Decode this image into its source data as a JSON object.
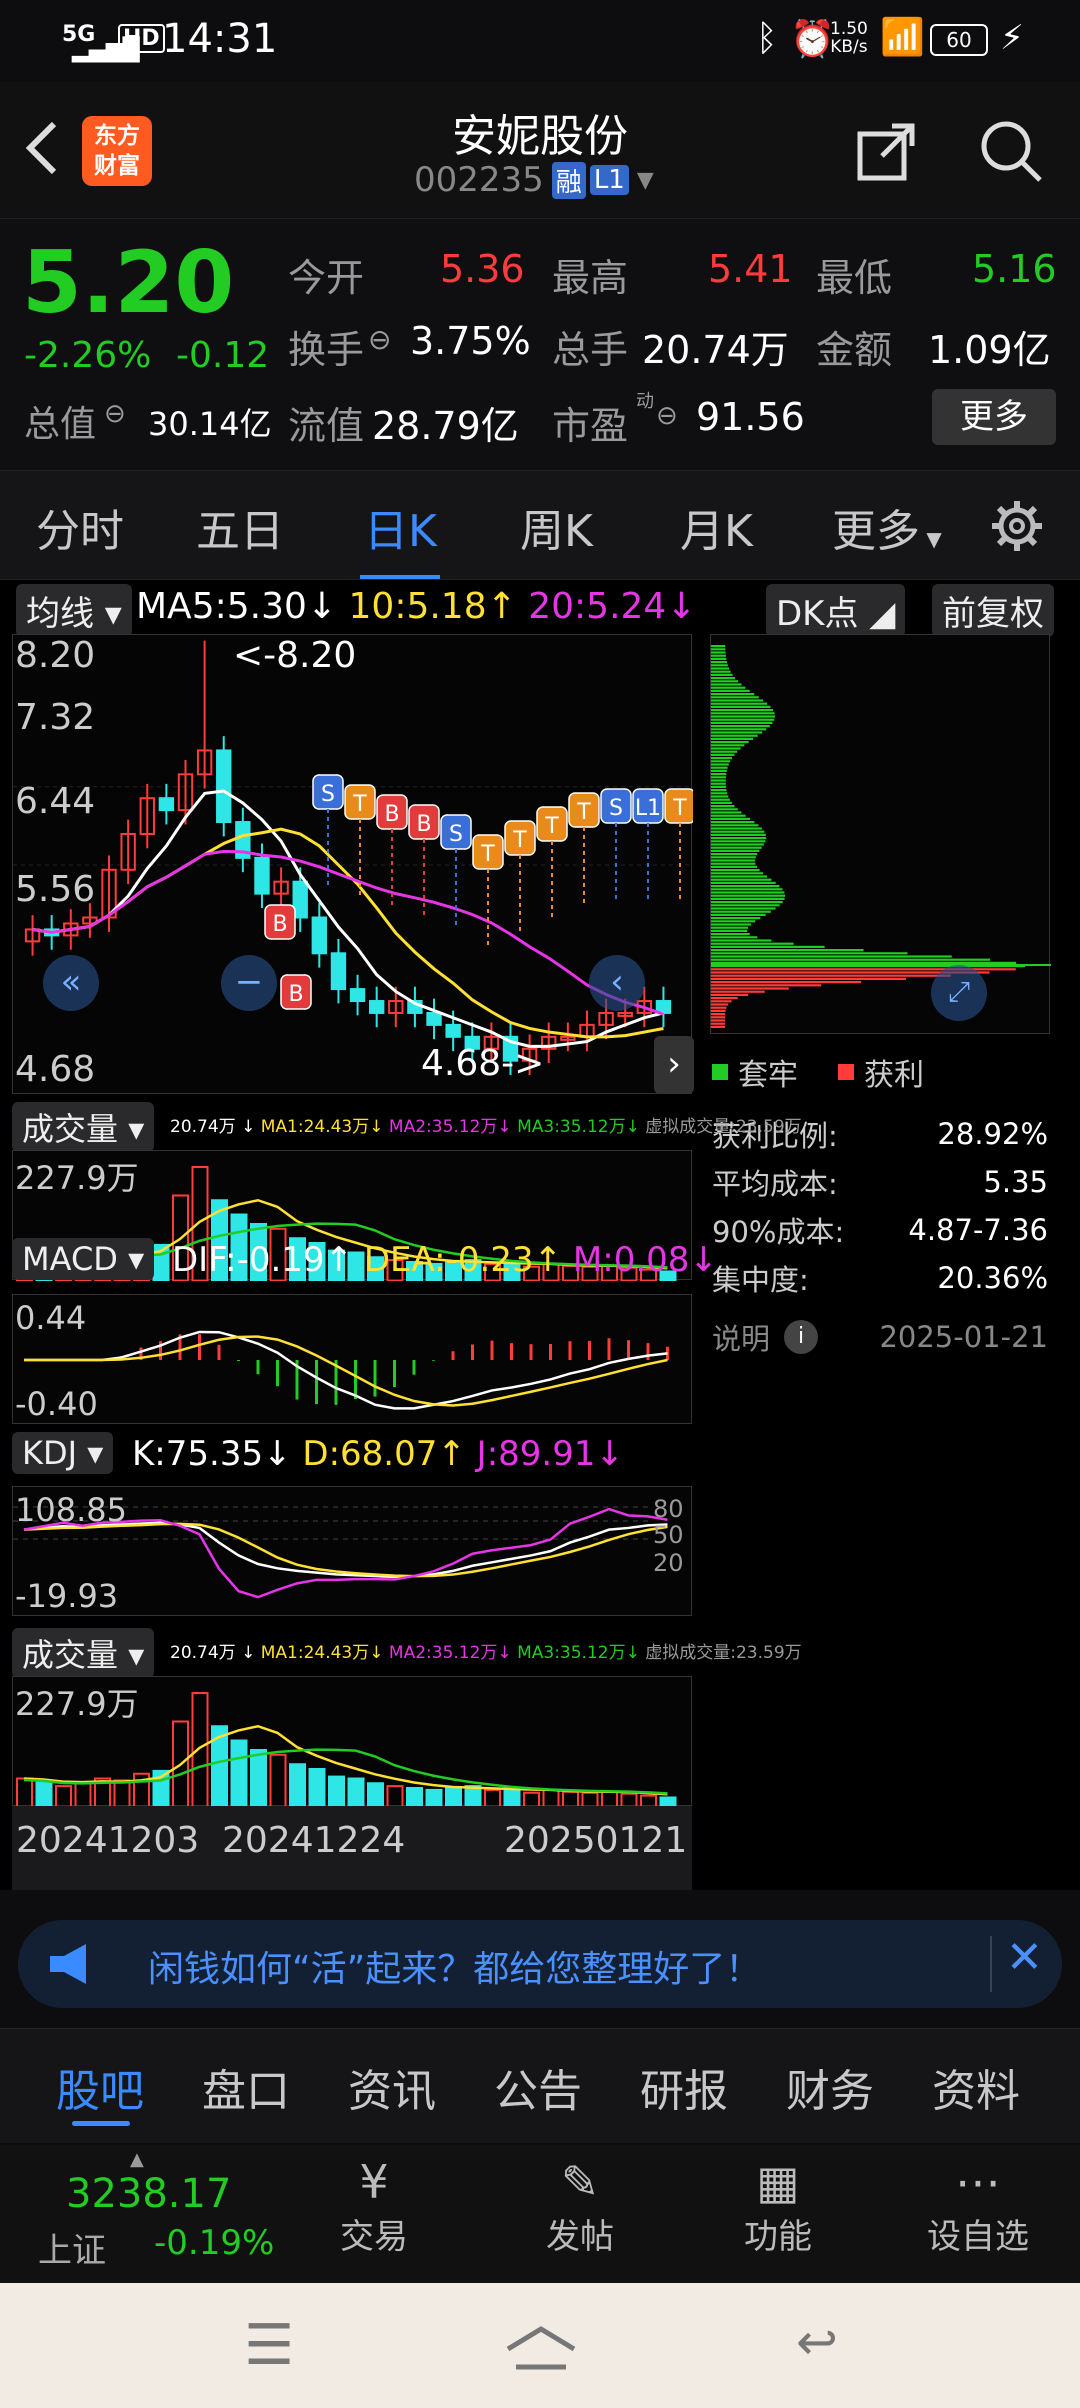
{
  "status": {
    "network": "5G",
    "hd": "HD",
    "time": "14:31",
    "speed": "1.50",
    "speed_unit": "KB/s",
    "battery": "60"
  },
  "header": {
    "logo_line1": "东方",
    "logo_line2": "财富",
    "title": "安妮股份",
    "code": "002235",
    "badge_rong": "融",
    "badge_level": "L1"
  },
  "quote": {
    "price": "5.20",
    "pct": "-2.26%",
    "chg": "-0.12",
    "open_label": "今开",
    "open": "5.36",
    "high_label": "最高",
    "high": "5.41",
    "low_label": "最低",
    "low": "5.16",
    "turnover_label": "换手",
    "turnover": "3.75%",
    "volume_label": "总手",
    "volume": "20.74万",
    "amount_label": "金额",
    "amount": "1.09亿",
    "mktcap_label": "总值",
    "mktcap": "30.14亿",
    "float_label": "流值",
    "float": "28.79亿",
    "pe_label": "市盈",
    "pe_sup": "动",
    "pe": "91.56",
    "more_button": "更多"
  },
  "tabs": [
    "分时",
    "五日",
    "日K",
    "周K",
    "月K",
    "更多"
  ],
  "active_tab": "日K",
  "kline": {
    "ma_selector": "均线",
    "ma5": "MA5:5.30",
    "ma10": "10:5.18",
    "ma20": "20:5.24",
    "dk_button": "DK点",
    "adjust_button": "前复权",
    "y_ticks": [
      "8.20",
      "7.32",
      "6.44",
      "5.56",
      "4.68"
    ],
    "max_marker": "<-8.20",
    "min_marker": "4.68->",
    "signals": [
      "S",
      "T",
      "B",
      "B",
      "S",
      "T",
      "T",
      "T",
      "T",
      "S",
      "L1",
      "T",
      "T",
      "S"
    ],
    "b_marks": [
      "B",
      "B"
    ]
  },
  "chip": {
    "legend_trapped": "套牢",
    "legend_profit": "获利",
    "rows": [
      {
        "label": "获利比例:",
        "value": "28.92%"
      },
      {
        "label": "平均成本:",
        "value": "5.35"
      },
      {
        "label": "90%成本:",
        "value": "4.87-7.36"
      },
      {
        "label": "集中度:",
        "value": "20.36%"
      }
    ],
    "note_label": "说明",
    "date": "2025-01-21"
  },
  "volume": {
    "selector": "成交量",
    "detail": "20.74万 ↓",
    "ma1": "MA1:24.43万↓",
    "ma2": "MA2:35.12万↓",
    "ma3": "MA3:35.12万↓",
    "virt": "虚拟成交量:23.59万",
    "top": "227.9万"
  },
  "macd": {
    "selector": "MACD",
    "dif": "DIF:-0.19",
    "dea": "DEA:-0.23",
    "m": "M:0.08",
    "top": "0.44",
    "bottom": "-0.40"
  },
  "kdj": {
    "selector": "KDJ",
    "k": "K:75.35",
    "d": "D:68.07",
    "j": "J:89.91",
    "top": "108.85",
    "bottom": "-19.93",
    "lv80": "80",
    "lv50": "50",
    "lv20": "20"
  },
  "volume2": {
    "selector": "成交量",
    "top": "227.9万"
  },
  "dates": [
    "20241203",
    "20241224",
    "20250121"
  ],
  "chart_data": {
    "type": "candlestick",
    "y_range": [
      4.68,
      8.2
    ],
    "note": "daily K-line approximations",
    "close_approx": [
      5.9,
      5.85,
      5.95,
      6.0,
      6.4,
      6.7,
      7.0,
      6.9,
      7.2,
      7.4,
      6.8,
      6.5,
      6.2,
      6.3,
      6.0,
      5.7,
      5.4,
      5.3,
      5.2,
      5.3,
      5.2,
      5.1,
      5.0,
      4.9,
      5.0,
      4.8,
      4.9,
      5.0,
      5.0,
      5.1,
      5.2,
      5.2,
      5.3,
      5.2
    ]
  },
  "notice": {
    "text": "闲钱如何“活”起来？都给您整理好了！"
  },
  "bottom_tabs": [
    "股吧",
    "盘口",
    "资讯",
    "公告",
    "研报",
    "财务",
    "资料"
  ],
  "footer": {
    "index_value": "3238.17",
    "index_name": "上证",
    "index_pct": "-0.19%",
    "trade": "交易",
    "post": "发帖",
    "functions": "功能",
    "watch": "设自选"
  }
}
